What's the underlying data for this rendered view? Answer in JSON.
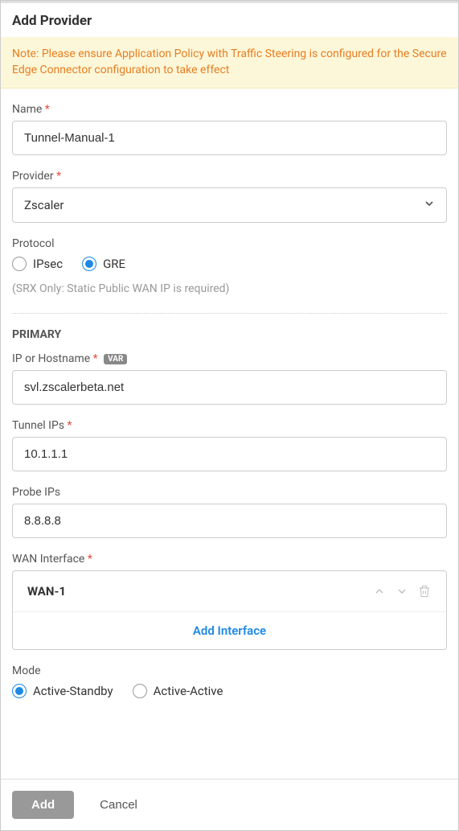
{
  "header": {
    "title": "Add Provider"
  },
  "note": "Note: Please ensure Application Policy with Traffic Steering is configured for the Secure Edge Connector configuration to take effect",
  "fields": {
    "name": {
      "label": "Name",
      "value": "Tunnel-Manual-1"
    },
    "provider": {
      "label": "Provider",
      "value": "Zscaler"
    },
    "protocol": {
      "label": "Protocol",
      "options": [
        "IPsec",
        "GRE"
      ],
      "selected": "GRE",
      "hint": "(SRX Only: Static Public WAN IP is required)"
    }
  },
  "primary": {
    "heading": "PRIMARY",
    "ip_hostname": {
      "label": "IP or Hostname",
      "var_badge": "VAR",
      "value": "svl.zscalerbeta.net"
    },
    "tunnel_ips": {
      "label": "Tunnel IPs",
      "value": "10.1.1.1"
    },
    "probe_ips": {
      "label": "Probe IPs",
      "value": "8.8.8.8"
    },
    "wan_interface": {
      "label": "WAN Interface",
      "items": [
        "WAN-1"
      ],
      "add_label": "Add Interface"
    }
  },
  "mode": {
    "label": "Mode",
    "options": [
      "Active-Standby",
      "Active-Active"
    ],
    "selected": "Active-Standby"
  },
  "footer": {
    "add": "Add",
    "cancel": "Cancel"
  }
}
